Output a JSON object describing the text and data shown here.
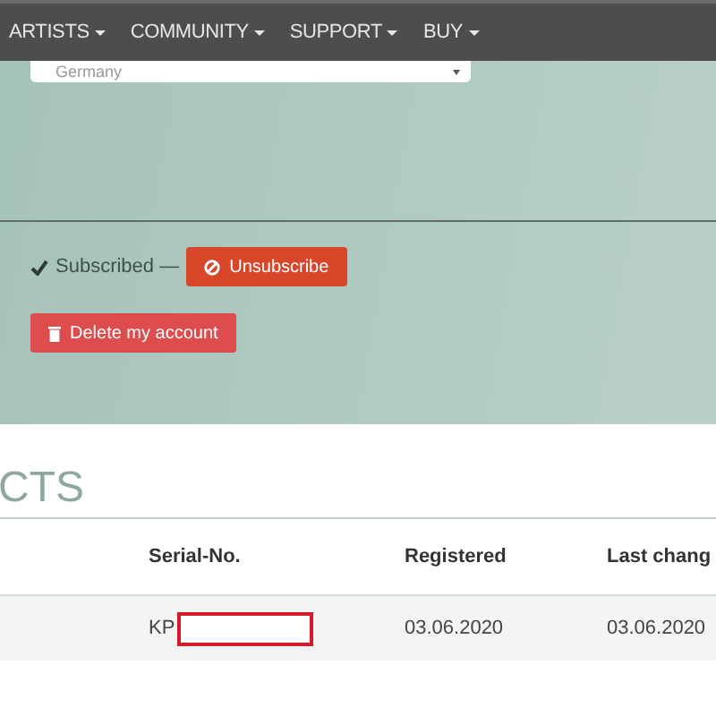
{
  "nav": {
    "items": [
      {
        "label": "ARTISTS"
      },
      {
        "label": "COMMUNITY"
      },
      {
        "label": "SUPPORT"
      },
      {
        "label": "BUY"
      }
    ]
  },
  "country_select": {
    "value": "Germany"
  },
  "subscription": {
    "status": "Subscribed —",
    "subscribed": true,
    "button": "Unsubscribe"
  },
  "delete_button": "Delete my account",
  "products": {
    "heading": "CTS",
    "columns": [
      "Serial-No.",
      "Registered",
      "Last chang"
    ],
    "rows": [
      {
        "serial": "KP",
        "redacted": true,
        "registered": "03.06.2020",
        "last_change": "03.06.2020"
      }
    ]
  }
}
